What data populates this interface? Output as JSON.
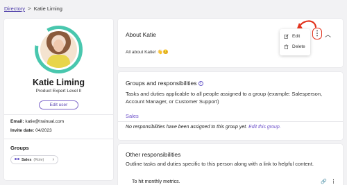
{
  "breadcrumb": {
    "root": "Directory",
    "separator": ">",
    "current": "Katie Liming"
  },
  "profile": {
    "name": "Katie Liming",
    "title": "Product Expert Level II",
    "edit_user": "Edit user",
    "email_label": "Email:",
    "email": "katie@trainual.com",
    "invite_label": "Invite date:",
    "invite_date": "04/2023",
    "groups_heading": "Groups",
    "group_chip": {
      "name": "Sales",
      "role": "(Role)"
    }
  },
  "about": {
    "heading": "About Katie",
    "body": "All about Katie! 👋😊",
    "menu": {
      "edit": "Edit",
      "delete": "Delete"
    }
  },
  "groups_section": {
    "heading": "Groups and responsibilities",
    "description": "Tasks and duties applicable to all people assigned to a group (example: Salesperson, Account Manager, or Customer Support)",
    "group_name": "Sales",
    "empty_text": "No responsibilities have been assigned to this group yet.",
    "empty_link": "Edit this group."
  },
  "other_section": {
    "heading": "Other responsibilities",
    "description": "Outline tasks and duties specific to this person along with a link to helpful content.",
    "items": [
      {
        "text": "To hit monthly metrics."
      }
    ]
  },
  "colors": {
    "accent": "#6b4fc9",
    "highlight": "#e2341e",
    "ring": "#49c7ae"
  }
}
